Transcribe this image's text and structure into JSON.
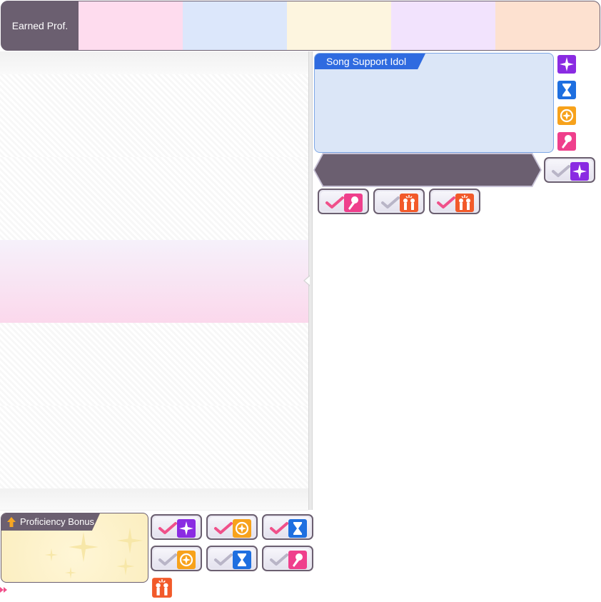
{
  "header": {
    "label": "Earned Prof.",
    "swatches": [
      "#fedcee",
      "#dce7fb",
      "#fdf5df",
      "#f2e3fd",
      "#fde1d0"
    ]
  },
  "support_panel": {
    "tab_label": "Song Support Idol",
    "side_icons": [
      "sparkle-icon",
      "hourglass-icon",
      "target-icon",
      "microphone-icon"
    ]
  },
  "banner_badge": {
    "checked": false,
    "icon": "sparkle-icon"
  },
  "support_badges": [
    {
      "checked": true,
      "icon": "microphone-icon"
    },
    {
      "checked": false,
      "icon": "gift-icon"
    },
    {
      "checked": true,
      "icon": "gift-icon"
    }
  ],
  "bonus": {
    "tab_label": "Proficiency Bonus",
    "badges": [
      {
        "checked": true,
        "icon": "sparkle-icon"
      },
      {
        "checked": true,
        "icon": "target-icon"
      },
      {
        "checked": true,
        "icon": "hourglass-icon"
      },
      {
        "checked": false,
        "icon": "target-icon"
      },
      {
        "checked": false,
        "icon": "hourglass-icon"
      },
      {
        "checked": false,
        "icon": "microphone-icon"
      }
    ],
    "extra_icon": "gift-icon"
  },
  "colors": {
    "accent_dark": "#6b5f70",
    "check_on": "#f0508a",
    "check_off": "#b9b5c7",
    "blue_tab": "#2f6be0"
  }
}
